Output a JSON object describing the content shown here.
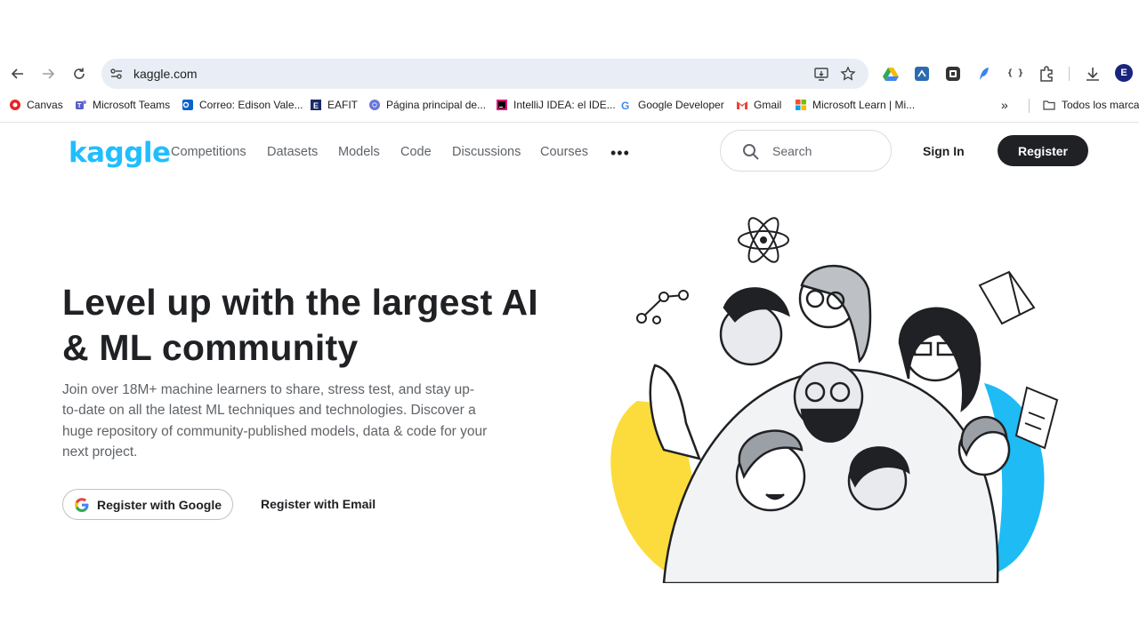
{
  "browser": {
    "url": "kaggle.com",
    "profile_initial": "E",
    "bookmarks": [
      {
        "label": "Canvas",
        "icon": "canvas-icon"
      },
      {
        "label": "Microsoft Teams",
        "icon": "teams-icon"
      },
      {
        "label": "Correo: Edison Vale...",
        "icon": "outlook-icon"
      },
      {
        "label": "EAFIT",
        "icon": "eafit-icon"
      },
      {
        "label": "Página principal de...",
        "icon": "chrome-icon"
      },
      {
        "label": "IntelliJ IDEA: el IDE...",
        "icon": "intellij-icon"
      },
      {
        "label": "Google Developer",
        "icon": "google-icon"
      },
      {
        "label": "Gmail",
        "icon": "gmail-icon"
      },
      {
        "label": "Microsoft Learn | Mi...",
        "icon": "microsoft-icon"
      }
    ],
    "all_bookmarks_label": "Todos los marcad"
  },
  "kaggle": {
    "logo": "kaggle",
    "nav": [
      "Competitions",
      "Datasets",
      "Models",
      "Code",
      "Discussions",
      "Courses"
    ],
    "more": "•••",
    "search_placeholder": "Search",
    "sign_in": "Sign In",
    "register": "Register",
    "hero": {
      "title_line1": "Level up with the largest AI",
      "title_line2": "& ML community",
      "subtitle": "Join over 18M+ machine learners to share, stress test, and stay up-to-date on all the latest ML techniques and technologies. Discover a huge repository of community-published models, data & code for your next project.",
      "google_button": "Register with Google",
      "email_button": "Register with Email"
    }
  },
  "colors": {
    "kaggle_blue": "#20beff",
    "dark_button": "#202124",
    "illustration_yellow": "#fbdc3c",
    "illustration_blue": "#1ebbf5"
  }
}
